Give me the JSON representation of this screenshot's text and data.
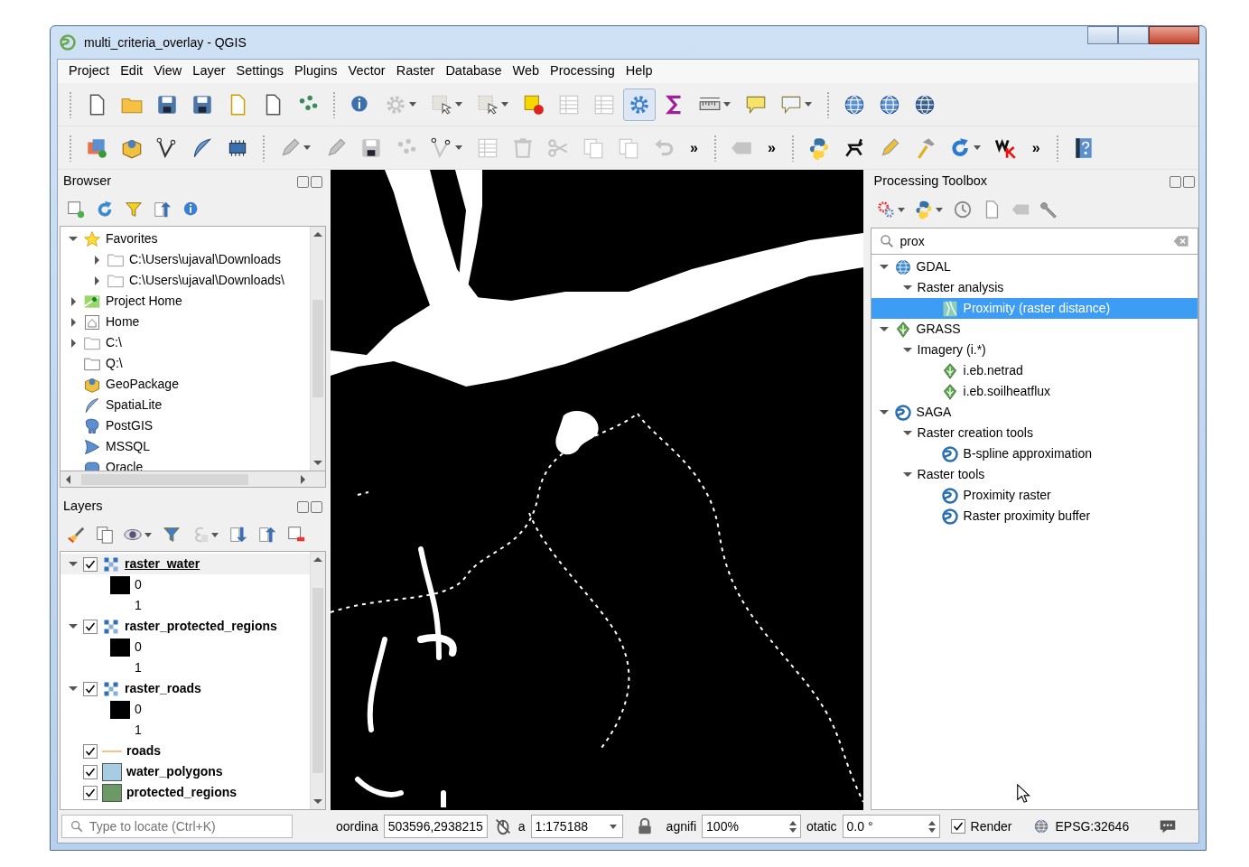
{
  "window": {
    "title": "multi_criteria_overlay - QGIS"
  },
  "menu": [
    "Project",
    "Edit",
    "View",
    "Layer",
    "Settings",
    "Plugins",
    "Vector",
    "Raster",
    "Database",
    "Web",
    "Processing",
    "Help"
  ],
  "toolbars": [
    {
      "items": [
        {
          "kind": "button",
          "disabled": false,
          "pressed": false,
          "menu": false
        },
        {
          "kind": "button",
          "disabled": false,
          "pressed": false,
          "menu": false
        },
        {
          "kind": "button",
          "disabled": false,
          "pressed": false,
          "menu": false
        },
        {
          "kind": "button",
          "disabled": false,
          "pressed": false,
          "menu": false
        },
        {
          "kind": "button",
          "disabled": false,
          "pressed": false,
          "menu": false
        },
        {
          "kind": "button",
          "disabled": false,
          "pressed": false,
          "menu": false
        },
        {
          "kind": "button",
          "disabled": false,
          "pressed": false,
          "menu": false
        },
        {
          "kind": "separator"
        },
        {
          "kind": "button",
          "disabled": false,
          "pressed": false,
          "menu": false
        },
        {
          "kind": "button",
          "disabled": true,
          "pressed": false,
          "menu": true
        },
        {
          "kind": "button",
          "disabled": true,
          "pressed": false,
          "menu": true
        },
        {
          "kind": "button",
          "disabled": true,
          "pressed": false,
          "menu": true
        },
        {
          "kind": "button",
          "disabled": false,
          "pressed": false,
          "menu": false
        },
        {
          "kind": "button",
          "disabled": true,
          "pressed": false,
          "menu": false
        },
        {
          "kind": "button",
          "disabled": true,
          "pressed": false,
          "menu": false
        },
        {
          "kind": "button",
          "disabled": false,
          "pressed": true,
          "menu": false
        },
        {
          "kind": "button",
          "disabled": false,
          "pressed": false,
          "menu": false
        },
        {
          "kind": "button",
          "disabled": false,
          "pressed": false,
          "menu": true
        },
        {
          "kind": "button",
          "disabled": false,
          "pressed": false,
          "menu": false
        },
        {
          "kind": "button",
          "disabled": false,
          "pressed": false,
          "menu": true
        },
        {
          "kind": "separator"
        },
        {
          "kind": "button",
          "disabled": false,
          "pressed": false,
          "menu": false
        },
        {
          "kind": "button",
          "disabled": false,
          "pressed": false,
          "menu": false
        },
        {
          "kind": "button",
          "disabled": false,
          "pressed": false,
          "menu": false
        }
      ]
    },
    {
      "items": [
        {
          "kind": "button",
          "disabled": false,
          "pressed": false,
          "menu": false
        },
        {
          "kind": "button",
          "disabled": false,
          "pressed": false,
          "menu": false
        },
        {
          "kind": "button",
          "disabled": false,
          "pressed": false,
          "menu": false
        },
        {
          "kind": "button",
          "disabled": false,
          "pressed": false,
          "menu": false
        },
        {
          "kind": "button",
          "disabled": false,
          "pressed": false,
          "menu": false
        },
        {
          "kind": "separator"
        },
        {
          "kind": "button",
          "disabled": true,
          "pressed": false,
          "menu": true
        },
        {
          "kind": "button",
          "disabled": true,
          "pressed": false,
          "menu": false
        },
        {
          "kind": "button",
          "disabled": true,
          "pressed": false,
          "menu": false
        },
        {
          "kind": "button",
          "disabled": true,
          "pressed": false,
          "menu": false
        },
        {
          "kind": "button",
          "disabled": true,
          "pressed": false,
          "menu": true
        },
        {
          "kind": "button",
          "disabled": true,
          "pressed": false,
          "menu": false
        },
        {
          "kind": "button",
          "disabled": true,
          "pressed": false,
          "menu": false
        },
        {
          "kind": "button",
          "disabled": true,
          "pressed": false,
          "menu": false
        },
        {
          "kind": "button",
          "disabled": true,
          "pressed": false,
          "menu": false
        },
        {
          "kind": "button",
          "disabled": true,
          "pressed": false,
          "menu": false
        },
        {
          "kind": "button",
          "disabled": true,
          "pressed": false,
          "menu": false
        },
        {
          "kind": "overflow",
          "label": "»"
        },
        {
          "kind": "separator"
        },
        {
          "kind": "button",
          "disabled": true,
          "pressed": false,
          "menu": false
        },
        {
          "kind": "overflow",
          "label": "»"
        },
        {
          "kind": "separator"
        },
        {
          "kind": "button",
          "disabled": false,
          "pressed": false,
          "menu": false
        },
        {
          "kind": "button",
          "disabled": false,
          "pressed": false,
          "menu": false
        },
        {
          "kind": "button",
          "disabled": false,
          "pressed": false,
          "menu": false
        },
        {
          "kind": "button",
          "disabled": false,
          "pressed": false,
          "menu": false
        },
        {
          "kind": "button",
          "disabled": false,
          "pressed": false,
          "menu": true
        },
        {
          "kind": "button",
          "disabled": false,
          "pressed": false,
          "menu": false
        },
        {
          "kind": "overflow",
          "label": "»"
        },
        {
          "kind": "separator"
        },
        {
          "kind": "button",
          "disabled": false,
          "pressed": false,
          "menu": false
        }
      ]
    }
  ],
  "browser": {
    "title": "Browser",
    "toolbar": [
      {
        "disabled": false,
        "menu": false
      },
      {
        "disabled": false,
        "menu": false
      },
      {
        "disabled": false,
        "menu": false
      },
      {
        "disabled": false,
        "menu": false
      },
      {
        "disabled": false,
        "menu": false
      }
    ],
    "items": [
      {
        "label": "Favorites",
        "kind": "favorites",
        "expanded": true,
        "children": [
          {
            "label": "C:\\Users\\ujaval\\Downloads",
            "kind": "folder",
            "expanded": false
          },
          {
            "label": "C:\\Users\\ujaval\\Downloads\\",
            "kind": "folder",
            "expanded": false
          }
        ]
      },
      {
        "label": "Project Home",
        "kind": "project",
        "expanded": false
      },
      {
        "label": "Home",
        "kind": "home",
        "expanded": false
      },
      {
        "label": "C:\\",
        "kind": "folder",
        "expanded": false
      },
      {
        "label": "Q:\\",
        "kind": "drive"
      },
      {
        "label": "GeoPackage",
        "kind": "geopackage"
      },
      {
        "label": "SpatiaLite",
        "kind": "spatialite"
      },
      {
        "label": "PostGIS",
        "kind": "postgis"
      },
      {
        "label": "MSSQL",
        "kind": "mssql"
      },
      {
        "label": "Oracle",
        "kind": "oracle"
      }
    ]
  },
  "layers": {
    "title": "Layers",
    "toolbar": [
      {
        "disabled": false,
        "menu": false
      },
      {
        "disabled": false,
        "menu": false
      },
      {
        "disabled": false,
        "menu": true
      },
      {
        "disabled": false,
        "menu": false
      },
      {
        "disabled": true,
        "menu": true
      },
      {
        "disabled": false,
        "menu": false
      },
      {
        "disabled": false,
        "menu": false
      },
      {
        "disabled": false,
        "menu": false
      }
    ],
    "items": [
      {
        "label": "raster_water",
        "kind": "raster",
        "checked": true,
        "selected": true,
        "expanded": true,
        "children": [
          {
            "label": "0",
            "color": "#000000"
          },
          {
            "label": "1"
          }
        ]
      },
      {
        "label": "raster_protected_regions",
        "kind": "raster",
        "checked": true,
        "selected": false,
        "expanded": true,
        "children": [
          {
            "label": "0",
            "color": "#000000"
          },
          {
            "label": "1"
          }
        ]
      },
      {
        "label": "raster_roads",
        "kind": "raster",
        "checked": true,
        "selected": false,
        "expanded": true,
        "children": [
          {
            "label": "0",
            "color": "#000000"
          },
          {
            "label": "1"
          }
        ]
      },
      {
        "label": "roads",
        "kind": "line",
        "checked": true,
        "selected": false,
        "color": "#f3c48a"
      },
      {
        "label": "water_polygons",
        "kind": "polygon",
        "checked": true,
        "selected": false,
        "color": "#a7cde3"
      },
      {
        "label": "protected_regions",
        "kind": "polygon",
        "checked": true,
        "selected": false,
        "color": "#6b9a67"
      }
    ]
  },
  "locator": {
    "placeholder": "Type to locate (Ctrl+K)"
  },
  "toolbox": {
    "title": "Processing Toolbox",
    "toolbar": [
      {
        "disabled": false,
        "menu": true
      },
      {
        "disabled": false,
        "menu": true
      },
      {
        "disabled": false,
        "menu": false
      },
      {
        "disabled": false,
        "menu": false
      },
      {
        "disabled": true,
        "menu": false
      },
      {
        "disabled": false,
        "menu": false
      }
    ],
    "search": "prox",
    "items": [
      {
        "label": "GDAL",
        "kind": "gdal",
        "selected": false,
        "expanded": true,
        "children": [
          {
            "label": "Raster analysis",
            "selected": false,
            "expanded": true,
            "children": [
              {
                "label": "Proximity (raster distance)",
                "kind": "gdal-tool",
                "selected": true
              }
            ]
          }
        ]
      },
      {
        "label": "GRASS",
        "kind": "grass",
        "selected": false,
        "expanded": true,
        "children": [
          {
            "label": "Imagery (i.*)",
            "selected": false,
            "expanded": true,
            "children": [
              {
                "label": "i.eb.netrad",
                "kind": "grass",
                "selected": false
              },
              {
                "label": "i.eb.soilheatflux",
                "kind": "grass",
                "selected": false
              }
            ]
          }
        ]
      },
      {
        "label": "SAGA",
        "kind": "saga",
        "selected": false,
        "expanded": true,
        "children": [
          {
            "label": "Raster creation tools",
            "selected": false,
            "expanded": true,
            "children": [
              {
                "label": "B-spline approximation",
                "kind": "saga",
                "selected": false
              }
            ]
          },
          {
            "label": "Raster tools",
            "selected": false,
            "expanded": true,
            "children": [
              {
                "label": "Proximity raster",
                "kind": "saga",
                "selected": false
              },
              {
                "label": "Raster proximity buffer",
                "kind": "saga",
                "selected": false
              }
            ]
          }
        ]
      }
    ]
  },
  "status_bar": {
    "coordinate_label": "oordina",
    "coordinate": "503596,2938215",
    "scale_label": "a",
    "scale": "1:175188",
    "magnifier_label": "agnifi",
    "magnifier": "100%",
    "rotation_label": "otatic",
    "rotation": "0.0 °",
    "render": {
      "label": "Render",
      "checked": true
    },
    "crs": "EPSG:32646"
  }
}
